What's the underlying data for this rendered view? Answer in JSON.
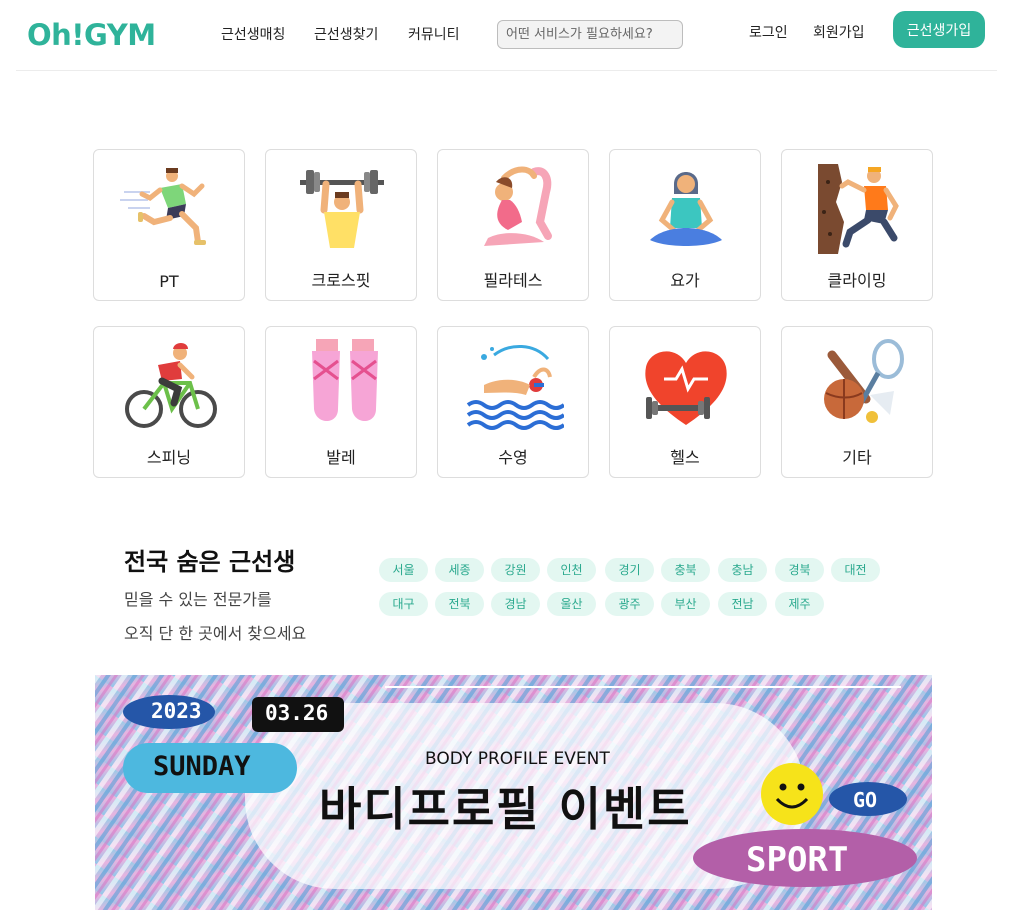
{
  "header": {
    "logo": "Oh!GYM",
    "nav": [
      "근선생매칭",
      "근선생찾기",
      "커뮤니티"
    ],
    "search_placeholder": "어떤 서비스가 필요하세요?",
    "login": "로그인",
    "join": "회원가입",
    "trainer_signup": "근선생가입",
    "accent_color": "#2fb39a"
  },
  "categories": [
    {
      "label": "PT",
      "icon": "running-icon"
    },
    {
      "label": "크로스핏",
      "icon": "weightlifting-icon"
    },
    {
      "label": "필라테스",
      "icon": "pilates-icon"
    },
    {
      "label": "요가",
      "icon": "yoga-icon"
    },
    {
      "label": "클라이밍",
      "icon": "climbing-icon"
    },
    {
      "label": "스피닝",
      "icon": "cycling-icon"
    },
    {
      "label": "발레",
      "icon": "ballet-shoes-icon"
    },
    {
      "label": "수영",
      "icon": "swimming-icon"
    },
    {
      "label": "헬스",
      "icon": "heart-dumbbell-icon"
    },
    {
      "label": "기타",
      "icon": "sports-equipment-icon"
    }
  ],
  "section": {
    "title": "전국 숨은 근선생",
    "subtitle_1": "믿을 수 있는 전문가를",
    "subtitle_2": "오직 단 한 곳에서 찾으세요",
    "regions_row1": [
      "서울",
      "세종",
      "강원",
      "인천",
      "경기",
      "충북",
      "충남",
      "경북",
      "대전"
    ],
    "regions_row2": [
      "대구",
      "전북",
      "경남",
      "울산",
      "광주",
      "부산",
      "전남",
      "제주"
    ]
  },
  "banner": {
    "year": "2023",
    "date": "03.26",
    "day": "SUNDAY",
    "event_en": "BODY PROFILE EVENT",
    "event_ko": "바디프로필 이벤트",
    "go": "GO",
    "sport": "SPORT"
  }
}
